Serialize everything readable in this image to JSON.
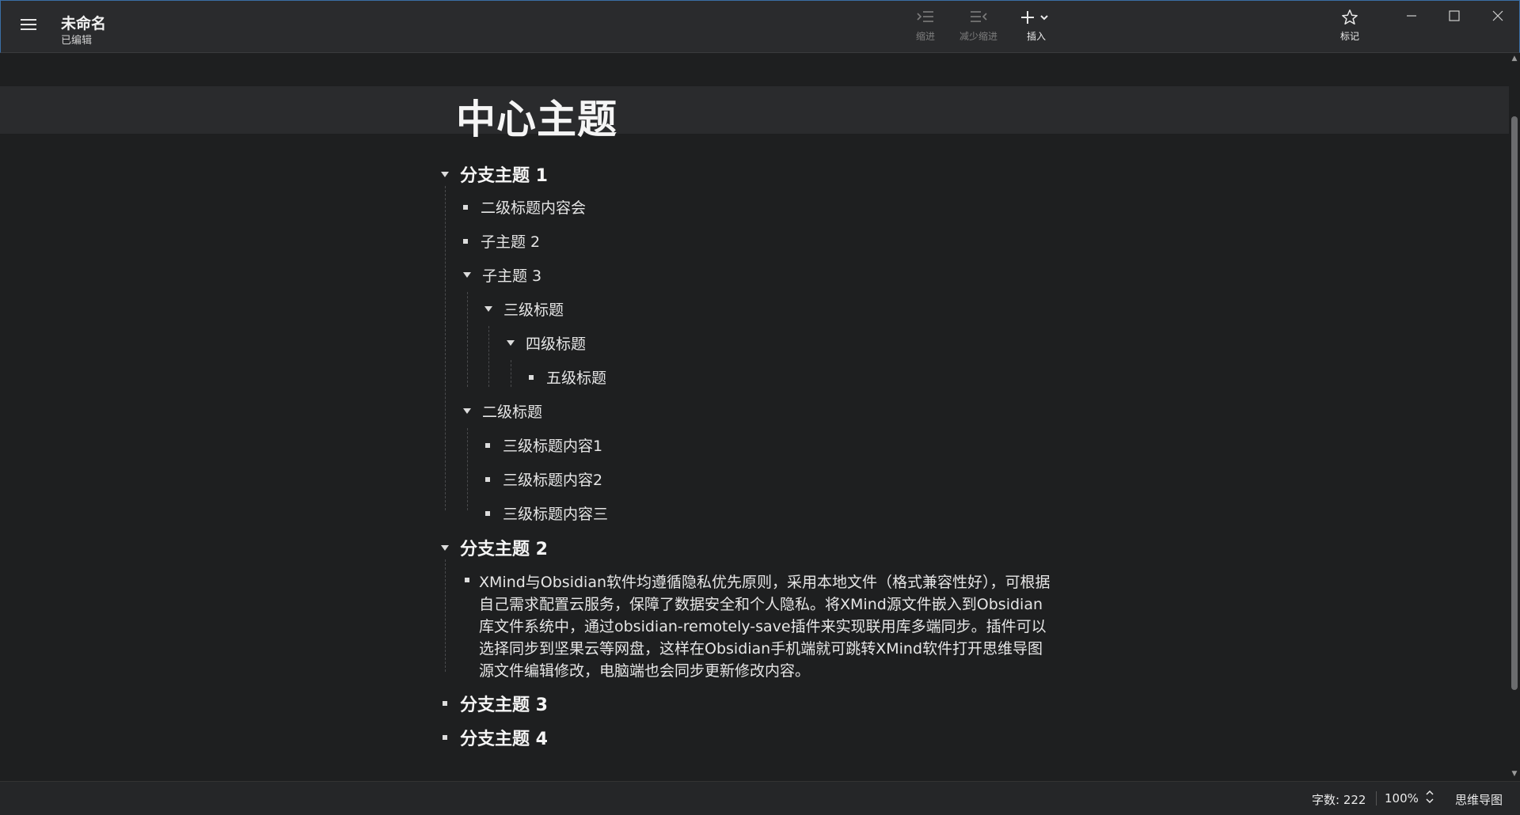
{
  "titlebar": {
    "doc_title": "未命名",
    "doc_status": "已编辑",
    "tools": {
      "indent": "缩进",
      "outdent": "减少缩进",
      "insert": "插入",
      "mark": "标记"
    }
  },
  "outline": {
    "central": "中心主题",
    "branch1": {
      "label": "分支主题 1",
      "items": {
        "a": "二级标题内容会",
        "b": "子主题 2",
        "c": "子主题 3",
        "c1": "三级标题",
        "c2": "四级标题",
        "c3": "五级标题",
        "d": "二级标题",
        "d1": "三级标题内容1",
        "d2": "三级标题内容2",
        "d3": "三级标题内容三"
      }
    },
    "branch2": {
      "label": "分支主题 2",
      "paragraph": "XMind与Obsidian软件均遵循隐私优先原则，采用本地文件（格式兼容性好），可根据自己需求配置云服务，保障了数据安全和个人隐私。将XMind源文件嵌入到Obsidian库文件系统中，通过obsidian-remotely-save插件来实现联用库多端同步。插件可以选择同步到坚果云等网盘，这样在Obsidian手机端就可跳转XMind软件打开思维导图源文件编辑修改，电脑端也会同步更新修改内容。"
    },
    "branch3": "分支主题 3",
    "branch4": "分支主题 4"
  },
  "statusbar": {
    "word_count": "字数: 222",
    "zoom": "100%",
    "view_mode": "思维导图"
  }
}
